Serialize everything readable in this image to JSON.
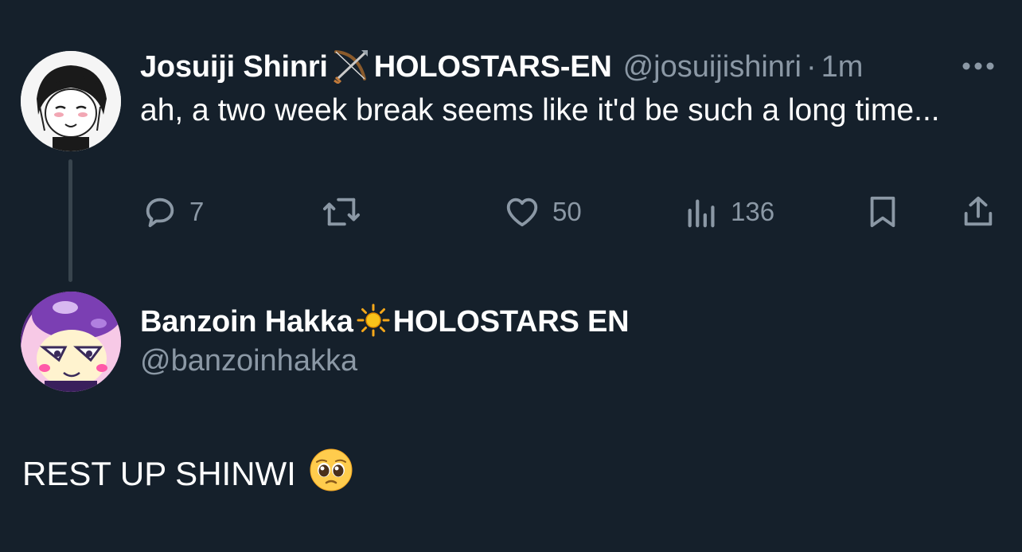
{
  "tweet": {
    "author": {
      "display_name": "Josuiji Shinri",
      "badge_icon": "bow-and-arrow-icon",
      "affiliation": "HOLOSTARS-EN",
      "handle": "@josuijishinri",
      "separator": "·",
      "timestamp": "1m"
    },
    "text": "ah, a two week break seems like it'd be such a long time...",
    "actions": {
      "replies": "7",
      "likes": "50",
      "views": "136"
    }
  },
  "reply": {
    "author": {
      "display_name": "Banzoin Hakka",
      "badge_icon": "sun-icon",
      "affiliation": "HOLOSTARS EN",
      "handle": "@banzoinhakka"
    },
    "text": "REST UP SHINWI",
    "emoji_icon": "pleading-face-icon"
  },
  "colors": {
    "background": "#15202b",
    "secondary_text": "#8b98a5",
    "thread_line": "#38444d"
  }
}
